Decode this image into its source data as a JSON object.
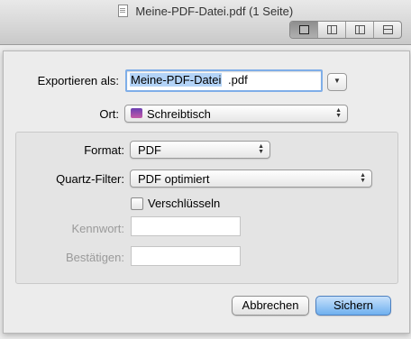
{
  "window": {
    "title": "Meine-PDF-Datei.pdf (1 Seite)"
  },
  "toolbar": {
    "view_icons": [
      "single-page-icon",
      "two-column-icon",
      "two-pages-icon",
      "grid-icon"
    ]
  },
  "dialog": {
    "export_label": "Exportieren als:",
    "filename_base": "Meine-PDF-Datei",
    "filename_ext": ".pdf",
    "location_label": "Ort:",
    "location_value": "Schreibtisch",
    "format_label": "Format:",
    "format_value": "PDF",
    "filter_label": "Quartz-Filter:",
    "filter_value": "PDF optimiert",
    "encrypt_label": "Verschlüsseln",
    "password_label": "Kennwort:",
    "confirm_label": "Bestätigen:",
    "cancel_label": "Abbrechen",
    "save_label": "Sichern"
  },
  "colors": {
    "accent": "#6fb0ef",
    "selection": "#b3d3f7",
    "focus_ring": "#7faee8"
  }
}
